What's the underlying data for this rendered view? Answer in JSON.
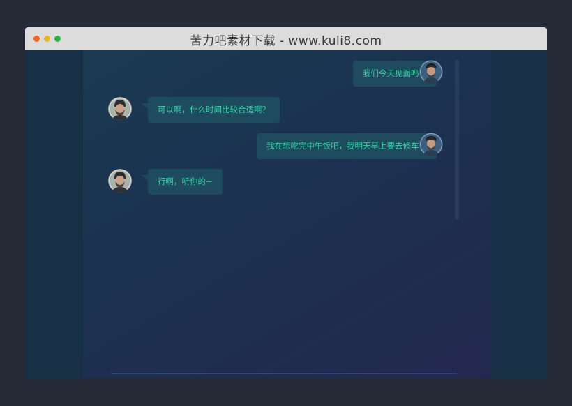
{
  "window": {
    "title": "苦力吧素材下载 - www.kuli8.com"
  },
  "chat": {
    "messages": [
      {
        "side": "right",
        "text": "我们今天见面吗？"
      },
      {
        "side": "left",
        "text": "可以啊，什么时间比较合适啊？"
      },
      {
        "side": "right",
        "text": "我在想吃完中午饭吧，我明天早上要去修车！"
      },
      {
        "side": "left",
        "text": "行啊，听你的~"
      }
    ]
  },
  "colors": {
    "background": "#252a36",
    "titlebar": "#dcdcdc",
    "bubble": "#1f4b5e",
    "bubble_text": "#2fd6a8",
    "close_dot": "#f0661e",
    "minimize_dot": "#e5b626",
    "maximize_dot": "#2cb33c"
  },
  "icons": {
    "user_avatar": "avatar-bearded-man-beanie",
    "contact_avatar": "avatar-man-dark-hair"
  }
}
